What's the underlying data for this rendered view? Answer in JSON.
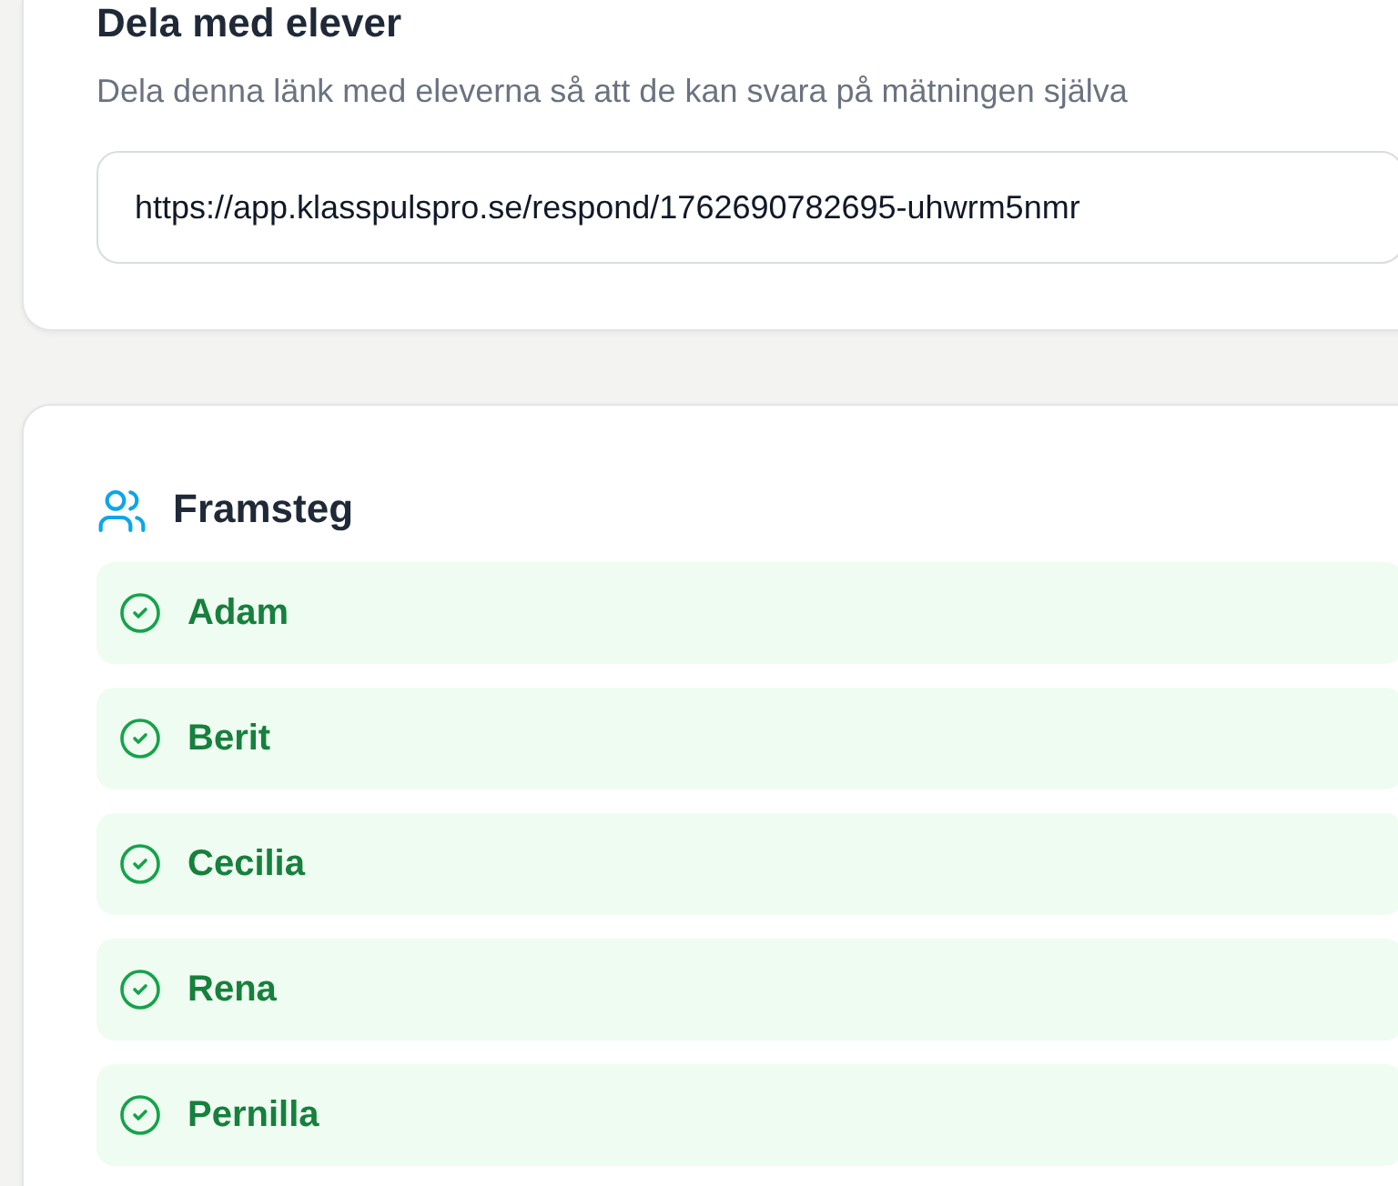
{
  "share_card": {
    "title": "Dela med elever",
    "description": "Dela denna länk med eleverna så att de kan svara på mätningen själva",
    "link": "https://app.klasspulspro.se/respond/1762690782695-uhwrm5nmr"
  },
  "progress_card": {
    "title": "Framsteg",
    "students": [
      {
        "name": "Adam",
        "completed": true
      },
      {
        "name": "Berit",
        "completed": true
      },
      {
        "name": "Cecilia",
        "completed": true
      },
      {
        "name": "Rena",
        "completed": true
      },
      {
        "name": "Pernilla",
        "completed": true
      }
    ]
  }
}
